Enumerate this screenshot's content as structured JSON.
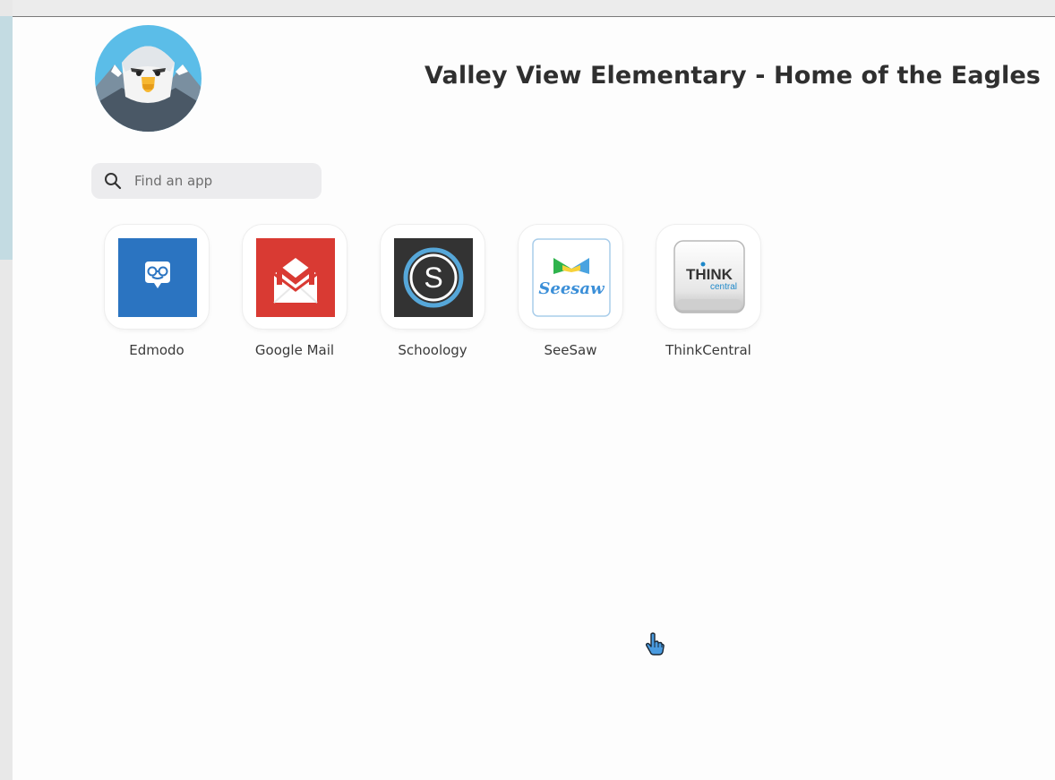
{
  "school": {
    "title": "Valley View Elementary - Home of the Eagles",
    "logo_icon": "eagle-mascot-icon"
  },
  "search": {
    "placeholder": "Find an app",
    "icon": "search-icon"
  },
  "apps": [
    {
      "label": "Edmodo",
      "icon": "edmodo-icon",
      "color": "#2b74c1"
    },
    {
      "label": "Google Mail",
      "icon": "gmail-icon",
      "color": "#d93a33"
    },
    {
      "label": "Schoology",
      "icon": "schoology-icon",
      "color": "#333333"
    },
    {
      "label": "SeeSaw",
      "icon": "seesaw-icon",
      "color": "#3b8fd8"
    },
    {
      "label": "ThinkCentral",
      "icon": "thinkcentral-icon",
      "color": "#1e88c9"
    }
  ],
  "seesaw_wordmark": "Seesaw",
  "think_wordmark": {
    "think": "THINK",
    "central": "central"
  },
  "cursor": "hand-pointer-icon"
}
